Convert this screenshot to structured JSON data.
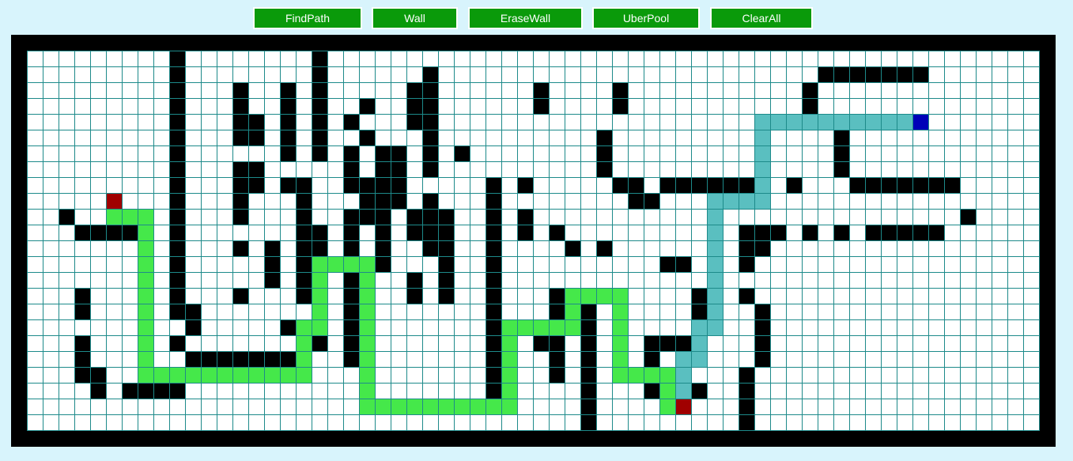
{
  "toolbar": {
    "buttons": [
      {
        "id": "findpath",
        "label": "FindPath"
      },
      {
        "id": "wall",
        "label": "Wall"
      },
      {
        "id": "erasewall",
        "label": "EraseWall"
      },
      {
        "id": "uberpool",
        "label": "UberPool"
      },
      {
        "id": "clearall",
        "label": "ClearAll"
      }
    ]
  },
  "grid": {
    "cols": 64,
    "rows": 24,
    "colors": {
      "empty": "#ffffff",
      "line": "#1d8a8a",
      "wall": "#000000",
      "endpoint": "#a00000",
      "start": "#0000b8",
      "path_green": "#45e84a",
      "path_teal": "#5abfc0"
    },
    "walls": [
      [
        9,
        0,
        1,
        17
      ],
      [
        18,
        0,
        1,
        7
      ],
      [
        25,
        1,
        1,
        6
      ],
      [
        32,
        2,
        1,
        2
      ],
      [
        37,
        2,
        1,
        2
      ],
      [
        49,
        2,
        1,
        2
      ],
      [
        50,
        1,
        7,
        1
      ],
      [
        16,
        2,
        1,
        5
      ],
      [
        13,
        2,
        1,
        2
      ],
      [
        21,
        3,
        1,
        1
      ],
      [
        24,
        4,
        1,
        1
      ],
      [
        32,
        3,
        1,
        1
      ],
      [
        37,
        3,
        1,
        1
      ],
      [
        14,
        4,
        1,
        2
      ],
      [
        20,
        4,
        1,
        1
      ],
      [
        24,
        2,
        1,
        3
      ],
      [
        13,
        7,
        1,
        3
      ],
      [
        21,
        5,
        1,
        1
      ],
      [
        23,
        6,
        1,
        4
      ],
      [
        27,
        6,
        1,
        1
      ],
      [
        20,
        6,
        1,
        1
      ],
      [
        16,
        8,
        2,
        1
      ],
      [
        17,
        8,
        1,
        1
      ],
      [
        13,
        4,
        1,
        1
      ],
      [
        13,
        5,
        1,
        1
      ],
      [
        13,
        8,
        1,
        1
      ],
      [
        13,
        10,
        1,
        1
      ],
      [
        13,
        12,
        1,
        1
      ],
      [
        14,
        7,
        1,
        2
      ],
      [
        20,
        7,
        1,
        2
      ],
      [
        22,
        6,
        1,
        8
      ],
      [
        20,
        10,
        1,
        10
      ],
      [
        21,
        8,
        1,
        3
      ],
      [
        25,
        6,
        1,
        2
      ],
      [
        26,
        10,
        1,
        6
      ],
      [
        24,
        10,
        1,
        2
      ],
      [
        25,
        9,
        1,
        4
      ],
      [
        24,
        14,
        1,
        2
      ],
      [
        17,
        9,
        1,
        7
      ],
      [
        18,
        11,
        1,
        8
      ],
      [
        16,
        17,
        1,
        1
      ],
      [
        15,
        12,
        1,
        3
      ],
      [
        13,
        15,
        1,
        1
      ],
      [
        9,
        16,
        2,
        1
      ],
      [
        10,
        17,
        1,
        1
      ],
      [
        10,
        19,
        8,
        1
      ],
      [
        9,
        18,
        1,
        1
      ],
      [
        40,
        8,
        6,
        1
      ],
      [
        36,
        5,
        1,
        3
      ],
      [
        37,
        8,
        2,
        1
      ],
      [
        38,
        9,
        2,
        1
      ],
      [
        48,
        8,
        1,
        1
      ],
      [
        51,
        5,
        1,
        3
      ],
      [
        52,
        8,
        7,
        1
      ],
      [
        59,
        10,
        1,
        1
      ],
      [
        46,
        11,
        2,
        1
      ],
      [
        46,
        12,
        1,
        1
      ],
      [
        49,
        11,
        1,
        1
      ],
      [
        51,
        11,
        1,
        1
      ],
      [
        53,
        11,
        3,
        1
      ],
      [
        56,
        11,
        2,
        1
      ],
      [
        45,
        11,
        1,
        1
      ],
      [
        45,
        12,
        1,
        2
      ],
      [
        31,
        8,
        1,
        1
      ],
      [
        33,
        11,
        1,
        1
      ],
      [
        34,
        12,
        1,
        1
      ],
      [
        36,
        12,
        1,
        1
      ],
      [
        31,
        10,
        1,
        2
      ],
      [
        29,
        8,
        1,
        14
      ],
      [
        33,
        15,
        1,
        2
      ],
      [
        35,
        16,
        1,
        8
      ],
      [
        33,
        18,
        1,
        3
      ],
      [
        30,
        18,
        1,
        2
      ],
      [
        32,
        18,
        1,
        1
      ],
      [
        40,
        13,
        2,
        1
      ],
      [
        42,
        15,
        1,
        2
      ],
      [
        39,
        18,
        3,
        1
      ],
      [
        39,
        19,
        1,
        1
      ],
      [
        39,
        20,
        1,
        2
      ],
      [
        45,
        15,
        1,
        1
      ],
      [
        46,
        16,
        1,
        4
      ],
      [
        45,
        20,
        1,
        4
      ],
      [
        42,
        21,
        1,
        1
      ],
      [
        2,
        10,
        1,
        1
      ],
      [
        3,
        11,
        4,
        1
      ],
      [
        3,
        15,
        1,
        2
      ],
      [
        3,
        18,
        1,
        3
      ],
      [
        4,
        20,
        1,
        2
      ],
      [
        6,
        21,
        4,
        1
      ]
    ],
    "endpoints": [
      [
        5,
        9
      ],
      [
        41,
        22
      ]
    ],
    "start": [
      56,
      4
    ],
    "path_green": [
      [
        5,
        10
      ],
      [
        6,
        10
      ],
      [
        7,
        10
      ],
      [
        7,
        11
      ],
      [
        7,
        12
      ],
      [
        7,
        13
      ],
      [
        7,
        14
      ],
      [
        7,
        15
      ],
      [
        7,
        16
      ],
      [
        7,
        17
      ],
      [
        7,
        18
      ],
      [
        7,
        19
      ],
      [
        8,
        20
      ],
      [
        9,
        20
      ],
      [
        10,
        20
      ],
      [
        11,
        20
      ],
      [
        12,
        20
      ],
      [
        13,
        20
      ],
      [
        14,
        20
      ],
      [
        15,
        20
      ],
      [
        16,
        20
      ],
      [
        17,
        20
      ],
      [
        7,
        20
      ],
      [
        17,
        19
      ],
      [
        17,
        18
      ],
      [
        17,
        17
      ],
      [
        18,
        17
      ],
      [
        18,
        16
      ],
      [
        18,
        15
      ],
      [
        18,
        14
      ],
      [
        19,
        13
      ],
      [
        20,
        13
      ],
      [
        18,
        13
      ],
      [
        21,
        13
      ],
      [
        21,
        14
      ],
      [
        21,
        15
      ],
      [
        21,
        16
      ],
      [
        21,
        17
      ],
      [
        21,
        18
      ],
      [
        21,
        19
      ],
      [
        21,
        20
      ],
      [
        21,
        21
      ],
      [
        21,
        22
      ],
      [
        22,
        22
      ],
      [
        23,
        22
      ],
      [
        24,
        22
      ],
      [
        25,
        22
      ],
      [
        26,
        22
      ],
      [
        27,
        22
      ],
      [
        28,
        22
      ],
      [
        29,
        22
      ],
      [
        30,
        22
      ],
      [
        30,
        21
      ],
      [
        30,
        20
      ],
      [
        30,
        19
      ],
      [
        30,
        18
      ],
      [
        30,
        17
      ],
      [
        31,
        17
      ],
      [
        32,
        17
      ],
      [
        33,
        17
      ],
      [
        34,
        17
      ],
      [
        34,
        16
      ],
      [
        34,
        15
      ],
      [
        35,
        15
      ],
      [
        36,
        15
      ],
      [
        37,
        15
      ],
      [
        37,
        16
      ],
      [
        37,
        17
      ],
      [
        37,
        18
      ],
      [
        37,
        19
      ],
      [
        37,
        20
      ],
      [
        38,
        20
      ],
      [
        39,
        20
      ],
      [
        40,
        20
      ],
      [
        40,
        21
      ],
      [
        40,
        22
      ]
    ],
    "path_teal": [
      [
        55,
        4
      ],
      [
        54,
        4
      ],
      [
        53,
        4
      ],
      [
        52,
        4
      ],
      [
        51,
        4
      ],
      [
        50,
        4
      ],
      [
        49,
        4
      ],
      [
        48,
        4
      ],
      [
        47,
        4
      ],
      [
        46,
        4
      ],
      [
        46,
        5
      ],
      [
        46,
        6
      ],
      [
        46,
        7
      ],
      [
        46,
        8
      ],
      [
        46,
        9
      ],
      [
        45,
        9
      ],
      [
        44,
        9
      ],
      [
        43,
        9
      ],
      [
        43,
        10
      ],
      [
        43,
        11
      ],
      [
        43,
        12
      ],
      [
        43,
        13
      ],
      [
        43,
        14
      ],
      [
        43,
        15
      ],
      [
        43,
        16
      ],
      [
        43,
        17
      ],
      [
        42,
        17
      ],
      [
        42,
        18
      ],
      [
        42,
        19
      ],
      [
        41,
        19
      ],
      [
        41,
        20
      ],
      [
        41,
        21
      ]
    ]
  }
}
